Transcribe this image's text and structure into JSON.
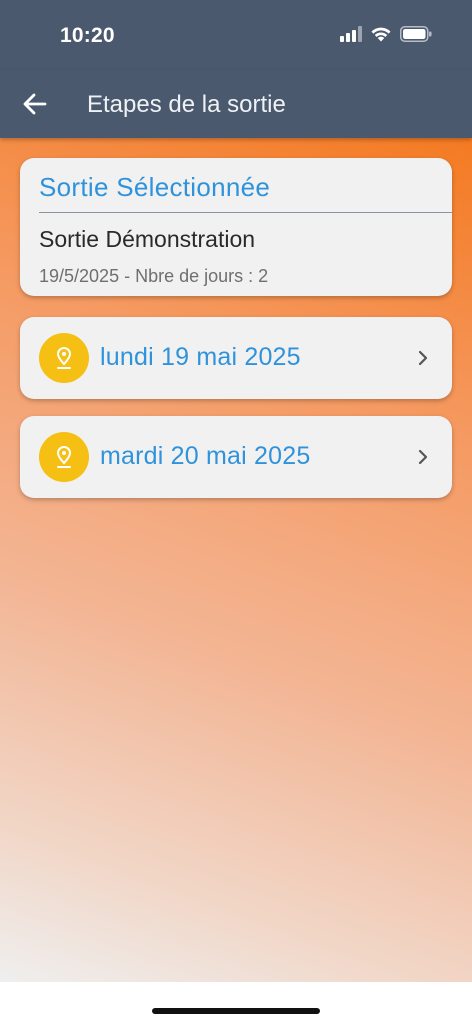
{
  "status_bar": {
    "time": "10:20"
  },
  "app_bar": {
    "title": "Etapes de la sortie"
  },
  "selected_outing": {
    "heading": "Sortie Sélectionnée",
    "name": "Sortie Démonstration",
    "meta": "19/5/2025 - Nbre de jours : 2"
  },
  "days": [
    {
      "label": "lundi 19 mai 2025"
    },
    {
      "label": "mardi 20 mai 2025"
    }
  ],
  "colors": {
    "app_bar": "#4b596e",
    "accent_blue": "#2f93dc",
    "pin_yellow": "#f5bf14",
    "gradient_orange": "#f47a22"
  }
}
